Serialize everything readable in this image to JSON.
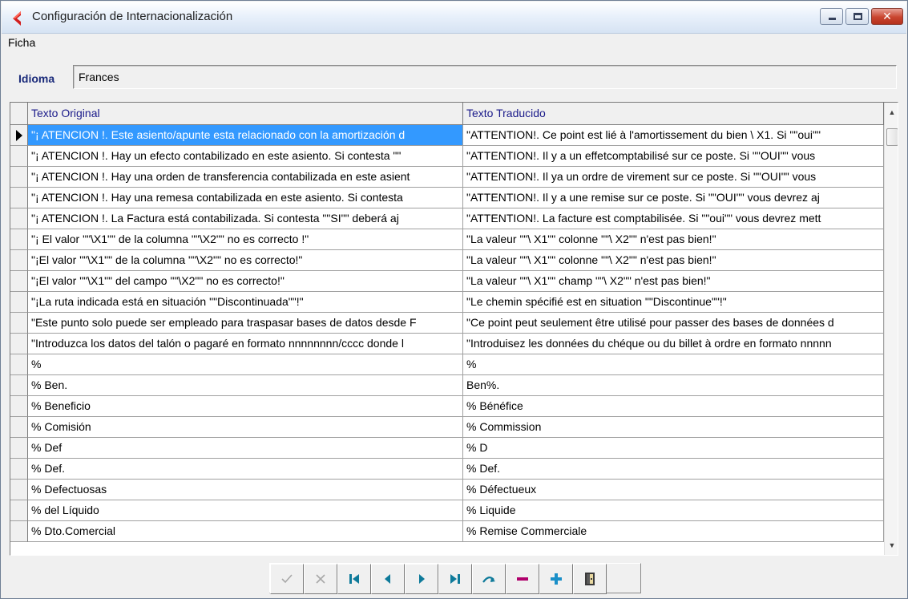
{
  "window": {
    "title": "Configuración de Internacionalización"
  },
  "menu": {
    "items": [
      {
        "label": "Ficha"
      }
    ]
  },
  "language": {
    "label": "Idioma",
    "value": "Frances"
  },
  "grid": {
    "columns": [
      "Texto Original",
      "Texto Traducido"
    ],
    "rows": [
      {
        "original": "\"¡ ATENCION !. Este asiento/apunte esta relacionado con la amortización d",
        "translated": "\"ATTENTION!. Ce point est lié à l'amortissement du bien \\ X1. Si \"\"oui\"\"",
        "selected": true
      },
      {
        "original": "\"¡ ATENCION !. Hay un efecto contabilizado en este asiento.  Si contesta \"\"",
        "translated": "\"ATTENTION!. Il y a un effetcomptabilisé sur ce poste. Si \"\"OUI\"\" vous"
      },
      {
        "original": "\"¡ ATENCION !. Hay una orden de transferencia contabilizada en este asient",
        "translated": "\"ATTENTION!. Il ya un ordre de virement sur ce poste. Si \"\"OUI\"\" vous"
      },
      {
        "original": "\"¡ ATENCION !. Hay una remesa contabilizada en este asiento.  Si contesta",
        "translated": "\"ATTENTION!. Il y a une remise sur ce poste. Si \"\"OUI\"\" vous devrez aj"
      },
      {
        "original": "\"¡ ATENCION !. La Factura está contabilizada.  Si contesta \"\"SI\"\" deberá aj",
        "translated": "\"ATTENTION!. La facture est comptabilisée. Si \"\"oui\"\" vous devrez mett"
      },
      {
        "original": "\"¡ El valor \"\"\\X1\"\" de la columna \"\"\\X2\"\" no es correcto !\"",
        "translated": "\"La valeur \"\"\\ X1\"\" colonne \"\"\\ X2\"\" n'est pas bien!\""
      },
      {
        "original": "\"¡El valor \"\"\\X1\"\" de la columna \"\"\\X2\"\" no es correcto!\"",
        "translated": "\"La valeur \"\"\\ X1\"\" colonne \"\"\\ X2\"\" n'est pas bien!\""
      },
      {
        "original": "\"¡El valor \"\"\\X1\"\" del campo \"\"\\X2\"\" no es correcto!\"",
        "translated": "\"La valeur \"\"\\ X1\"\" champ \"\"\\ X2\"\" n'est pas bien!\""
      },
      {
        "original": "\"¡La ruta indicada está en situación \"\"Discontinuada\"\"!\"",
        "translated": "\"Le chemin spécifié est en situation  \"\"Discontinue\"\"!\""
      },
      {
        "original": "\"Este punto solo puede ser empleado para traspasar bases de datos desde F",
        "translated": "\"Ce point peut seulement être utilisé pour passer des bases de données d"
      },
      {
        "original": "\"Introduzca los datos del talón o pagaré en formato nnnnnnnn/cccc donde l",
        "translated": "\"Introduisez les données du chéque ou du billet à ordre en formato nnnnn"
      },
      {
        "original": "%",
        "translated": "%"
      },
      {
        "original": "% Ben.",
        "translated": "Ben%."
      },
      {
        "original": "% Beneficio",
        "translated": "% Bénéfice"
      },
      {
        "original": "% Comisión",
        "translated": "% Commission"
      },
      {
        "original": "% Def",
        "translated": "% D"
      },
      {
        "original": "% Def.",
        "translated": "% Def."
      },
      {
        "original": "% Defectuosas",
        "translated": "% Défectueux"
      },
      {
        "original": "% del Líquido",
        "translated": "% Liquide"
      },
      {
        "original": "% Dto.Comercial",
        "translated": "% Remise Commerciale"
      }
    ]
  },
  "navigator": {
    "buttons": [
      {
        "name": "post-button",
        "icon": "check-icon",
        "enabled": false
      },
      {
        "name": "cancel-button",
        "icon": "x-icon",
        "enabled": false
      },
      {
        "name": "first-record-button",
        "icon": "first-icon",
        "enabled": true
      },
      {
        "name": "prior-record-button",
        "icon": "prior-icon",
        "enabled": true
      },
      {
        "name": "next-record-button",
        "icon": "next-icon",
        "enabled": true
      },
      {
        "name": "last-record-button",
        "icon": "last-icon",
        "enabled": true
      },
      {
        "name": "refresh-button",
        "icon": "refresh-icon",
        "enabled": true
      },
      {
        "name": "delete-record-button",
        "icon": "minus-icon",
        "enabled": true
      },
      {
        "name": "insert-record-button",
        "icon": "plus-icon",
        "enabled": true
      },
      {
        "name": "exit-button",
        "icon": "door-icon",
        "enabled": true
      }
    ]
  },
  "colors": {
    "selection": "#3399ff",
    "header_text": "#1a1a8a",
    "label_text": "#1a2a7a",
    "nav_arrow": "#0e7a9a",
    "delete": "#b0006b",
    "insert": "#1a8fc8",
    "app_icon": "#d21e1e"
  }
}
